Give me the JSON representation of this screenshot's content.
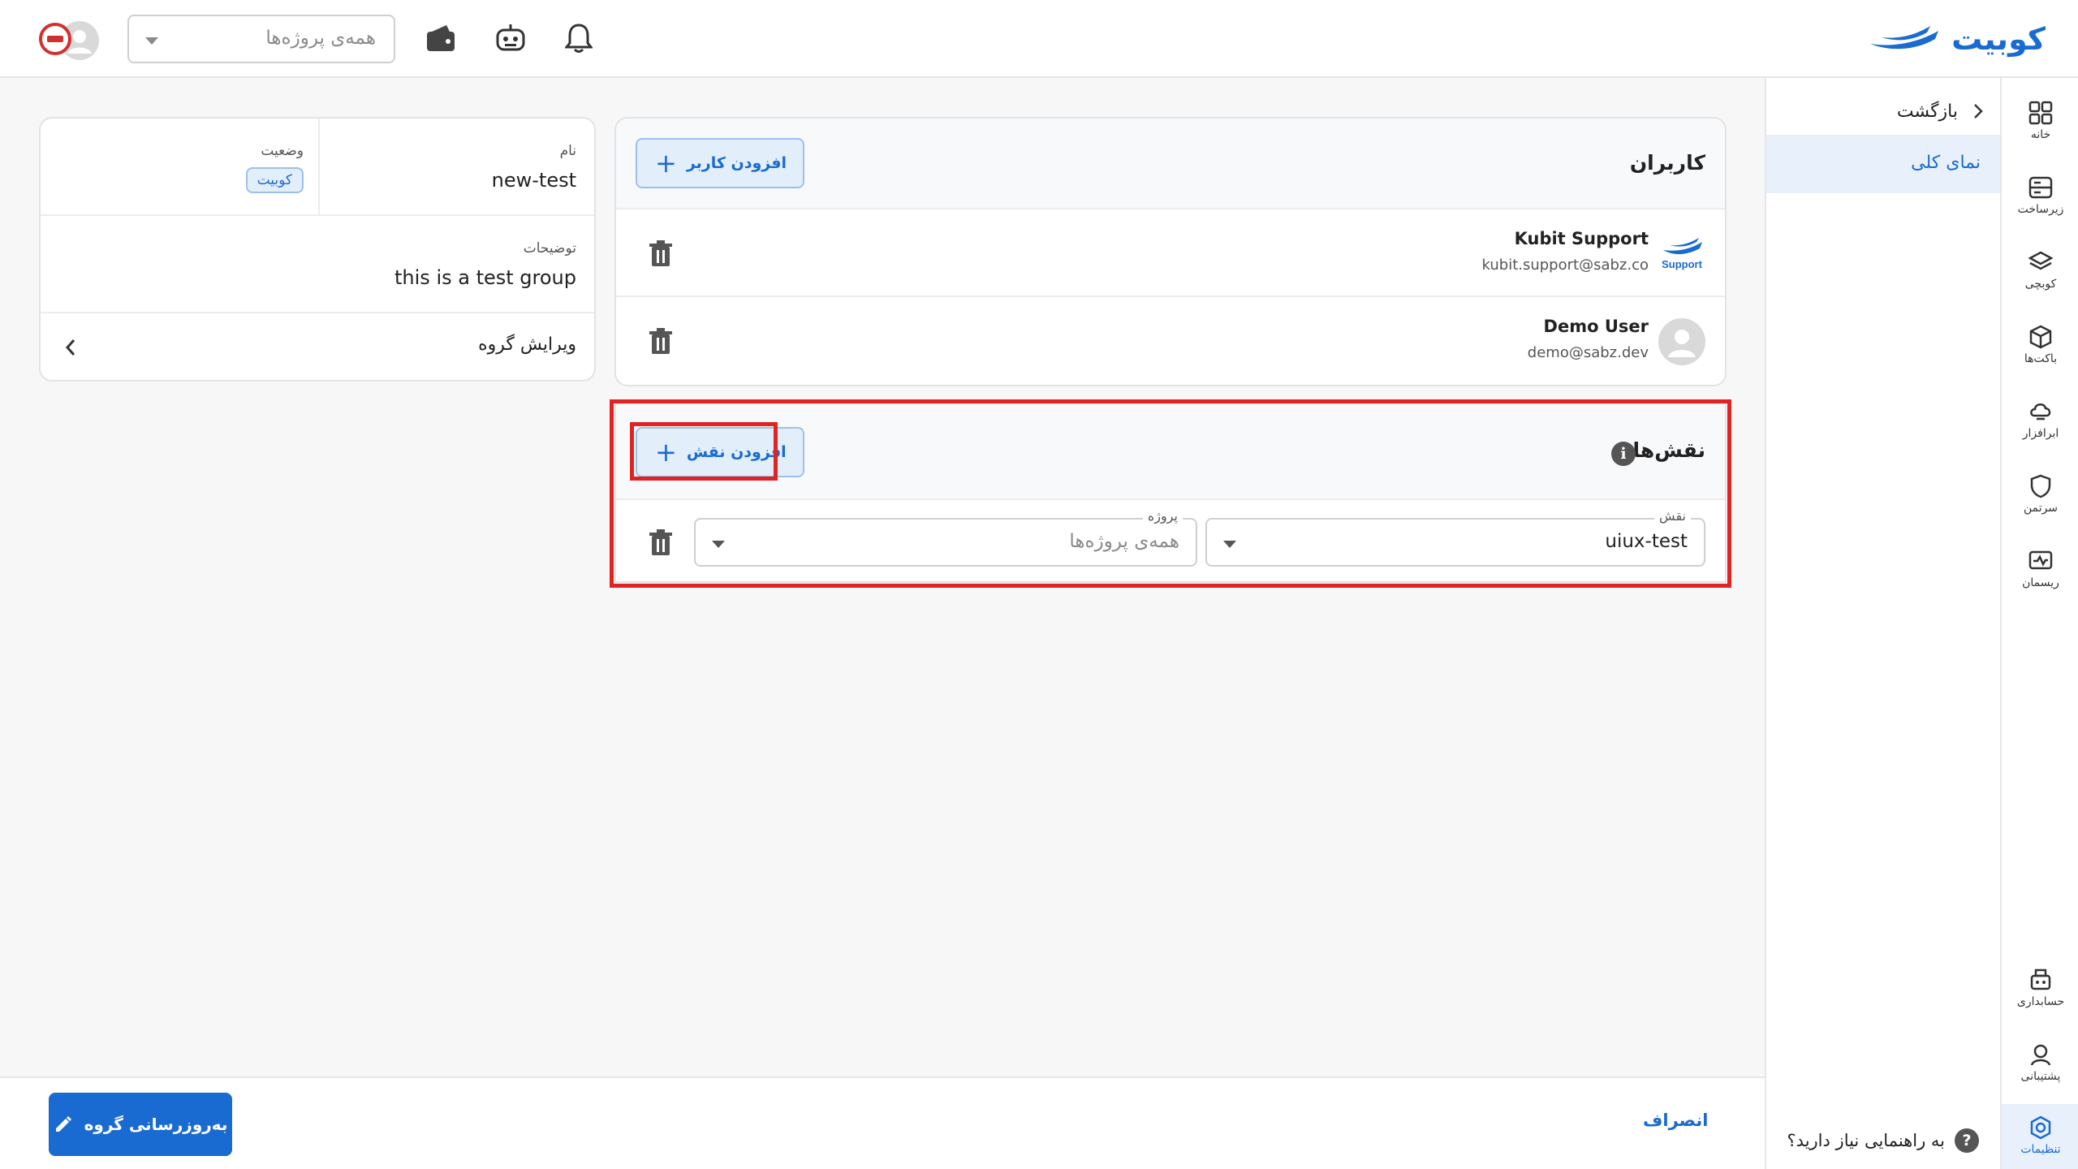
{
  "header": {
    "logo_text": "کوبیت",
    "project_placeholder": "همه‌ی پروژه‌ها"
  },
  "rail": {
    "items": [
      {
        "label": "خانه",
        "icon": "grid-icon"
      },
      {
        "label": "زیرساخت",
        "icon": "server-icon"
      },
      {
        "label": "کوبچی",
        "icon": "layers-icon"
      },
      {
        "label": "باکت‌ها",
        "icon": "box-icon"
      },
      {
        "label": "ابرافزار",
        "icon": "cloud-icon"
      },
      {
        "label": "سرتمن",
        "icon": "shield-icon"
      },
      {
        "label": "ریسمان",
        "icon": "monitor-icon"
      },
      {
        "label": "حسابداری",
        "icon": "billing-icon"
      },
      {
        "label": "پشتیبانی",
        "icon": "support-icon"
      },
      {
        "label": "تنظیمات",
        "icon": "settings-icon"
      }
    ],
    "active_label": "تنظیمات"
  },
  "subnav": {
    "back_label": "بازگشت",
    "overview_label": "نمای کلی",
    "help_label": "به راهنمایی نیاز دارید؟",
    "help_mark": "?"
  },
  "users": {
    "title": "کاربران",
    "add_label": "افزودن کاربر",
    "list": [
      {
        "name": "Kubit Support",
        "email": "kubit.support@sabz.co",
        "avatar_text": "Support"
      },
      {
        "name": "Demo User",
        "email": "demo@sabz.dev"
      }
    ]
  },
  "roles": {
    "title": "نقش‌ها",
    "add_label": "افزودن نقش",
    "role_legend": "نقش",
    "role_value": "uiux-test",
    "project_legend": "پروژه",
    "project_placeholder": "همه‌ی پروژه‌ها"
  },
  "group": {
    "name_label": "نام",
    "name_value": "new-test",
    "status_label": "وضعیت",
    "status_value": "کوبیت",
    "description_label": "توضیحات",
    "description_value": "this is a test group",
    "edit_label": "ویرایش گروه"
  },
  "footer": {
    "update_label": "به‌روزرسانی گروه",
    "cancel_label": "انصراف"
  },
  "colors": {
    "primary": "#1a6bd1",
    "highlight": "#e02424"
  }
}
